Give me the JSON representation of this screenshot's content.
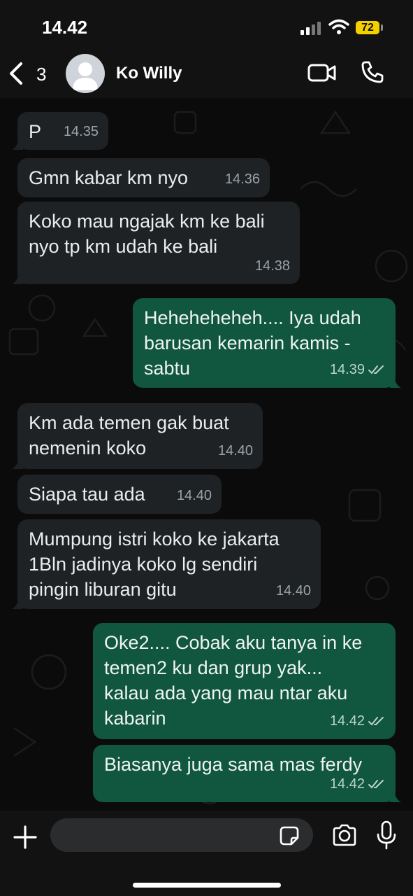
{
  "status_bar": {
    "time": "14.42",
    "battery": "72"
  },
  "header": {
    "back_count": "3",
    "contact_name": "Ko Willy",
    "icons": [
      "chevron-left-icon",
      "video-call-icon",
      "phone-icon"
    ]
  },
  "messages": [
    {
      "direction": "in",
      "text": "P",
      "time": "14.35"
    },
    {
      "direction": "in",
      "text": "Gmn kabar km nyo",
      "time": "14.36"
    },
    {
      "direction": "in",
      "text": "Koko mau ngajak km ke bali\nnyo tp km udah ke bali",
      "time": "14.38"
    },
    {
      "direction": "out",
      "text": "Heheheheheh.... Iya udah\nbarusan kemarin kamis -\nsabtu",
      "time": "14.39"
    },
    {
      "direction": "in",
      "text": "Km ada temen gak buat\nnemenin koko",
      "time": "14.40"
    },
    {
      "direction": "in",
      "text": "Siapa tau ada",
      "time": "14.40"
    },
    {
      "direction": "in",
      "text": "Mumpung istri koko ke jakarta\n1Bln jadinya koko lg sendiri\npingin liburan gitu",
      "time": "14.40"
    },
    {
      "direction": "out",
      "text": "Oke2.... Cobak aku tanya in ke\ntemen2  ku dan grup yak...\nkalau ada yang mau ntar aku\nkabarin",
      "time": "14.42"
    },
    {
      "direction": "out",
      "text": "Biasanya juga sama mas ferdy",
      "time": "14.42"
    }
  ],
  "composer": {
    "placeholder": "",
    "icons": [
      "plus-icon",
      "sticker-icon",
      "camera-icon",
      "mic-icon"
    ]
  },
  "colors": {
    "incoming_bubble": "#1f2224",
    "outgoing_bubble": "#11563f",
    "background": "#0b0b0b",
    "battery": "#f5d000"
  }
}
